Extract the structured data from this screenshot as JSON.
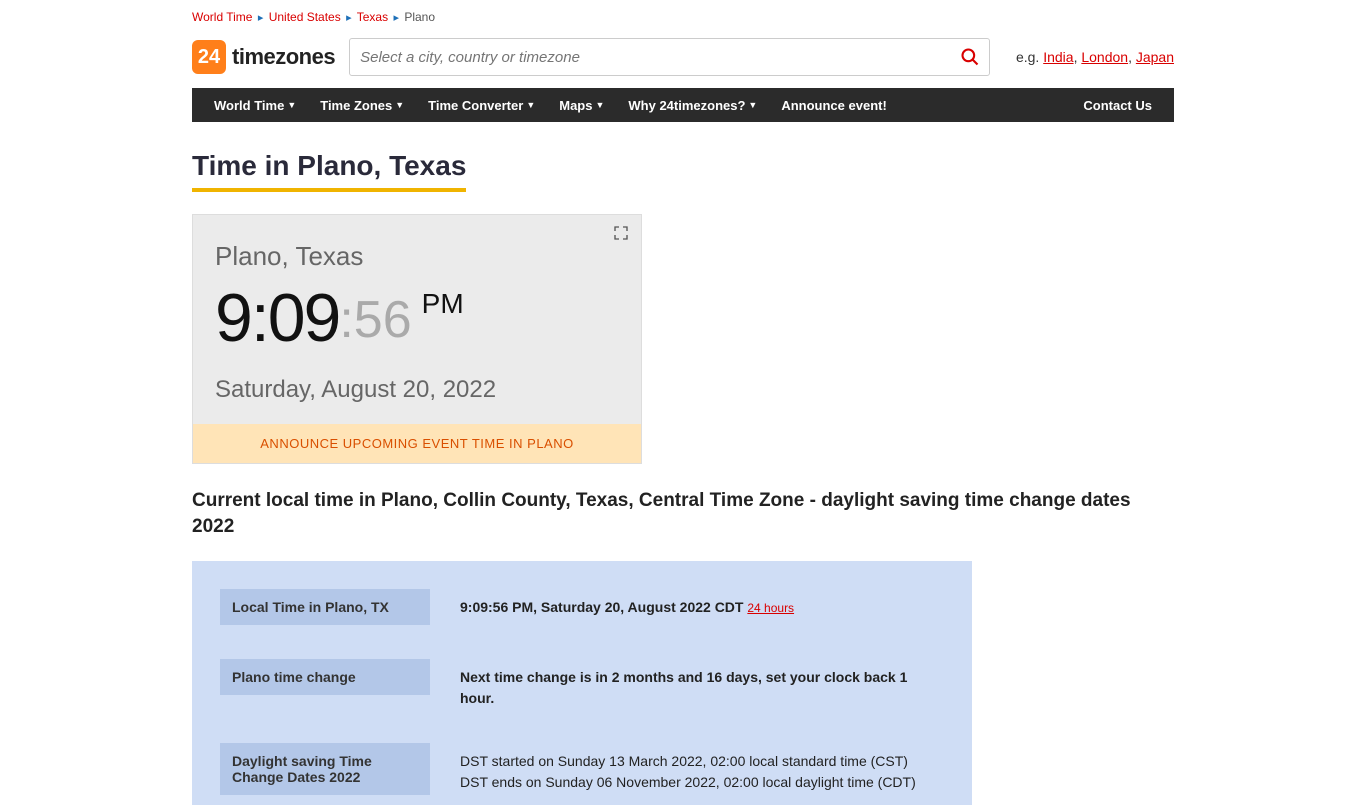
{
  "breadcrumb": {
    "items": [
      "World Time",
      "United States",
      "Texas"
    ],
    "current": "Plano"
  },
  "logo": {
    "badge": "24",
    "text": "timezones"
  },
  "search": {
    "placeholder": "Select a city, country or timezone"
  },
  "examples": {
    "prefix": "e.g. ",
    "links": [
      "India",
      "London",
      "Japan"
    ]
  },
  "nav": {
    "items": [
      "World Time",
      "Time Zones",
      "Time Converter",
      "Maps",
      "Why 24timezones?"
    ],
    "announce": "Announce event!",
    "contact": "Contact Us"
  },
  "title": "Time in Plano, Texas",
  "clock": {
    "location": "Plano, Texas",
    "hhmm": "9:09",
    "ss": ":56",
    "ampm": "PM",
    "date": "Saturday, August 20, 2022",
    "announce": "ANNOUNCE UPCOMING EVENT TIME IN PLANO"
  },
  "subtitle": "Current local time in Plano, Collin County, Texas, Central Time Zone - daylight saving time change dates 2022",
  "info": {
    "rows": [
      {
        "label": "Local Time in Plano, TX",
        "value_bold": "9:09:56 PM, Saturday 20, August 2022 CDT",
        "link": "24 hours"
      },
      {
        "label": "Plano time change",
        "value_bold": "Next time change is in 2 months and 16 days, set your clock back 1 hour."
      },
      {
        "label": "Daylight saving Time Change Dates 2022",
        "lines": [
          "DST started on Sunday 13 March 2022, 02:00 local standard time (CST)",
          "DST ends on Sunday 06 November 2022, 02:00 local daylight time (CDT)"
        ]
      }
    ]
  }
}
